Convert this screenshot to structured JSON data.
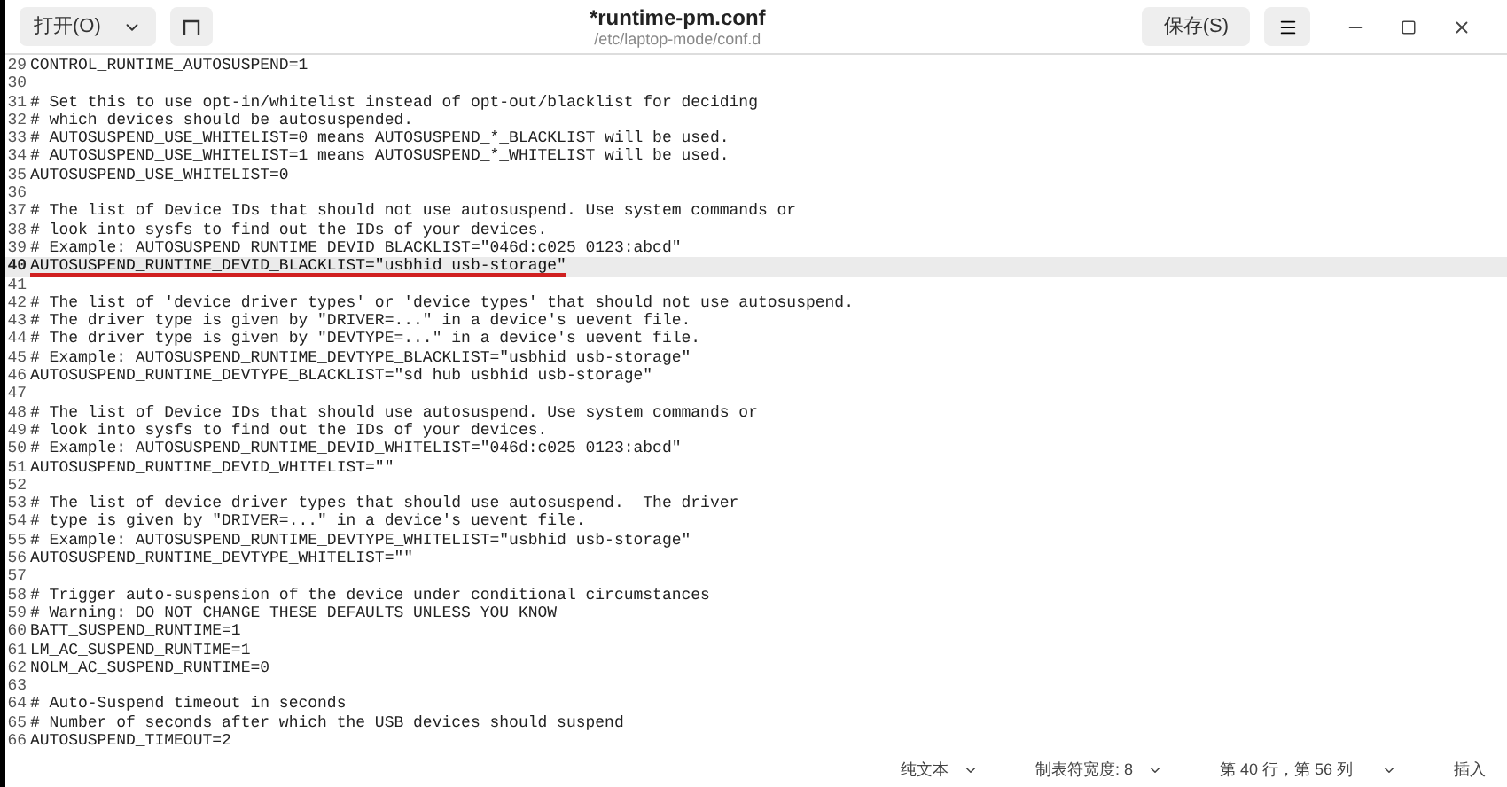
{
  "header": {
    "open_button": "打开(O)",
    "title": "*runtime-pm.conf",
    "subtitle": "/etc/laptop-mode/conf.d",
    "save_button": "保存(S)"
  },
  "lines": [
    {
      "number": "29",
      "text": "CONTROL_RUNTIME_AUTOSUSPEND=1",
      "current": false
    },
    {
      "number": "30",
      "current": false
    },
    {
      "number": "31",
      "text": "# Set this to use opt-in/whitelist instead of opt-out/blacklist for deciding",
      "current": false
    },
    {
      "number": "32",
      "text": "# which devices should be autosuspended.",
      "current": false
    },
    {
      "number": "33",
      "text": "# AUTOSUSPEND_USE_WHITELIST=0 means AUTOSUSPEND_*_BLACKLIST will be used.",
      "current": false
    },
    {
      "number": "34",
      "text": "# AUTOSUSPEND_USE_WHITELIST=1 means AUTOSUSPEND_*_WHITELIST will be used.",
      "current": false
    },
    {
      "number": "35",
      "text": "AUTOSUSPEND_USE_WHITELIST=0",
      "current": false
    },
    {
      "number": "36",
      "current": false
    },
    {
      "number": "37",
      "text": "# The list of Device IDs that should not use autosuspend. Use system commands or",
      "current": false
    },
    {
      "number": "38",
      "text": "# look into sysfs to find out the IDs of your devices.",
      "current": false
    },
    {
      "number": "39",
      "text": "# Example: AUTOSUSPEND_RUNTIME_DEVID_BLACKLIST=\"046d:c025 0123:abcd\"",
      "current": false
    },
    {
      "number": "40",
      "text": "AUTOSUSPEND_RUNTIME_DEVID_BLACKLIST=\"usbhid usb-storage\"",
      "current": true
    },
    {
      "number": "41",
      "current": false
    },
    {
      "number": "42",
      "text": "# The list of 'device driver types' or 'device types' that should not use autosuspend.",
      "current": false
    },
    {
      "number": "43",
      "text": "# The driver type is given by \"DRIVER=...\" in a device's uevent file.",
      "current": false
    },
    {
      "number": "44",
      "text": "# The driver type is given by \"DEVTYPE=...\" in a device's uevent file.",
      "current": false
    },
    {
      "number": "45",
      "text": "# Example: AUTOSUSPEND_RUNTIME_DEVTYPE_BLACKLIST=\"usbhid usb-storage\"",
      "current": false
    },
    {
      "number": "46",
      "text": "AUTOSUSPEND_RUNTIME_DEVTYPE_BLACKLIST=\"sd hub usbhid usb-storage\"",
      "current": false
    },
    {
      "number": "47",
      "current": false
    },
    {
      "number": "48",
      "text": "# The list of Device IDs that should use autosuspend. Use system commands or",
      "current": false
    },
    {
      "number": "49",
      "text": "# look into sysfs to find out the IDs of your devices.",
      "current": false
    },
    {
      "number": "50",
      "text": "# Example: AUTOSUSPEND_RUNTIME_DEVID_WHITELIST=\"046d:c025 0123:abcd\"",
      "current": false
    },
    {
      "number": "51",
      "text": "AUTOSUSPEND_RUNTIME_DEVID_WHITELIST=\"\"",
      "current": false
    },
    {
      "number": "52",
      "current": false
    },
    {
      "number": "53",
      "text": "# The list of device driver types that should use autosuspend.  The driver",
      "current": false
    },
    {
      "number": "54",
      "text": "# type is given by \"DRIVER=...\" in a device's uevent file.",
      "current": false
    },
    {
      "number": "55",
      "text": "# Example: AUTOSUSPEND_RUNTIME_DEVTYPE_WHITELIST=\"usbhid usb-storage\"",
      "current": false
    },
    {
      "number": "56",
      "text": "AUTOSUSPEND_RUNTIME_DEVTYPE_WHITELIST=\"\"",
      "current": false
    },
    {
      "number": "57",
      "current": false
    },
    {
      "number": "58",
      "text": "# Trigger auto-suspension of the device under conditional circumstances",
      "current": false
    },
    {
      "number": "59",
      "text": "# Warning: DO NOT CHANGE THESE DEFAULTS UNLESS YOU KNOW",
      "current": false
    },
    {
      "number": "60",
      "text": "BATT_SUSPEND_RUNTIME=1",
      "current": false
    },
    {
      "number": "61",
      "text": "LM_AC_SUSPEND_RUNTIME=1",
      "current": false
    },
    {
      "number": "62",
      "text": "NOLM_AC_SUSPEND_RUNTIME=0",
      "current": false
    },
    {
      "number": "63",
      "current": false
    },
    {
      "number": "64",
      "text": "# Auto-Suspend timeout in seconds",
      "current": false
    },
    {
      "number": "65",
      "text": "# Number of seconds after which the USB devices should suspend",
      "current": false
    },
    {
      "number": "66",
      "text": "AUTOSUSPEND_TIMEOUT=2",
      "current": false
    }
  ],
  "status_bar": {
    "language": "纯文本",
    "tab_width": "制表符宽度: 8",
    "position": "第 40 行，第 56 列",
    "mode": "插入"
  }
}
